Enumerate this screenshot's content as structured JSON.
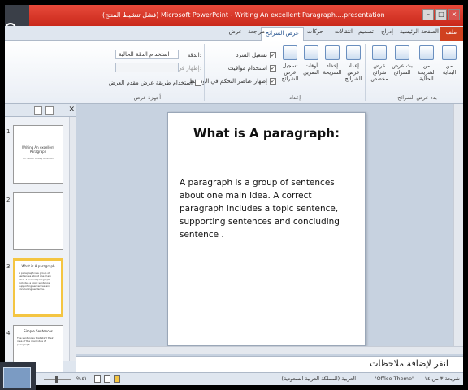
{
  "window": {
    "title": "(فشل تنشيط المنتج) Microsoft PowerPoint - Writing An excellent Paragraph....presentation"
  },
  "ribbon_tabs": [
    {
      "label": "ملف",
      "kind": "file"
    },
    {
      "label": "الصفحة الرئيسية"
    },
    {
      "label": "إدراج"
    },
    {
      "label": "تصميم"
    },
    {
      "label": "انتقالات"
    },
    {
      "label": "حركات"
    },
    {
      "label": "عرض الشرائح",
      "kind": "active"
    },
    {
      "label": "مراجعة"
    },
    {
      "label": "عرض"
    }
  ],
  "ribbon": {
    "start_group": {
      "label": "بدء عرض الشرائح",
      "from_beginning": "من البداية",
      "from_current": "من الشريحة الحالية",
      "broadcast": "بث عرض الشرائح",
      "custom": "عرض شرائح مخصص"
    },
    "setup_group": {
      "label": "إعداد",
      "setup": "إعداد عرض الشرائح",
      "hide": "إخفاء الشريحة",
      "rehearse": "أوقات التمرين",
      "record": "تسجيل عرض الشرائح",
      "play_narrations": "تشغيل السرد",
      "use_timings": "استخدام مواقيت",
      "show_media_controls": "إظهار عناصر التحكم في الوسائط"
    },
    "monitors_group": {
      "label": "أجهزة عرض",
      "resolution_label": "الدقة:",
      "resolution_value": "استخدام الدقة الحالية",
      "show_on_label": "إظهار في:",
      "presenter_view": "استخدام طريقة عرض مقدم العرض"
    }
  },
  "thumbnails": [
    {
      "num": "1",
      "title": "Writing An excellent Paragraph",
      "sub": "Dr. Abdul Khaliq Rhaman"
    },
    {
      "num": "2",
      "title": "",
      "sub": ""
    },
    {
      "num": "3",
      "title": "What is A paragraph",
      "body": "A paragraph is a group of sentences about one main idea. A correct paragraph includes a topic sentence, supporting sentences and concluding sentence."
    },
    {
      "num": "4",
      "title": "Simple Sentences",
      "body": "The sentences that start their idea of the main idea of paragraph..."
    }
  ],
  "slide": {
    "title": "What is A paragraph:",
    "body": "A paragraph is a group of sentences about one main idea. A correct paragraph includes a topic sentence, supporting sentences and concluding sentence ."
  },
  "notes": {
    "placeholder": "انقر لإضافة ملاحظات"
  },
  "status": {
    "slide_info": "شريحة ٣ من ١٤",
    "theme": "\"Office Theme\"",
    "language": "العربية (المملكة العربية السعودية)",
    "zoom": "%٤١"
  }
}
